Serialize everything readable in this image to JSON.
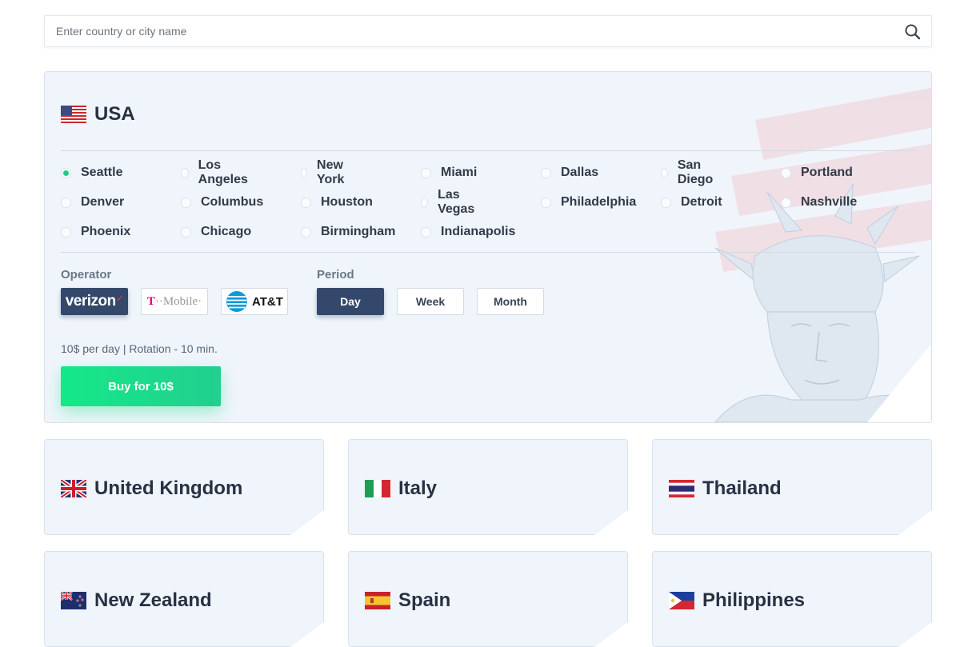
{
  "search": {
    "placeholder": "Enter country or city name"
  },
  "selected_country": {
    "name": "USA",
    "cities": [
      {
        "label": "Seattle",
        "selected": true
      },
      {
        "label": "Los Angeles",
        "selected": false
      },
      {
        "label": "New York",
        "selected": false
      },
      {
        "label": "Miami",
        "selected": false
      },
      {
        "label": "Dallas",
        "selected": false
      },
      {
        "label": "San Diego",
        "selected": false
      },
      {
        "label": "Portland",
        "selected": false
      },
      {
        "label": "Denver",
        "selected": false
      },
      {
        "label": "Columbus",
        "selected": false
      },
      {
        "label": "Houston",
        "selected": false
      },
      {
        "label": "Las Vegas",
        "selected": false
      },
      {
        "label": "Philadelphia",
        "selected": false
      },
      {
        "label": "Detroit",
        "selected": false
      },
      {
        "label": "Nashville",
        "selected": false
      },
      {
        "label": "Phoenix",
        "selected": false
      },
      {
        "label": "Chicago",
        "selected": false
      },
      {
        "label": "Birmingham",
        "selected": false
      },
      {
        "label": "Indianapolis",
        "selected": false
      }
    ],
    "operator_label": "Operator",
    "operators": [
      {
        "name": "verizon",
        "active": true
      },
      {
        "name": "T··Mobile·",
        "active": false
      },
      {
        "name": "AT&T",
        "active": false
      }
    ],
    "period_label": "Period",
    "periods": [
      {
        "label": "Day",
        "active": true
      },
      {
        "label": "Week",
        "active": false
      },
      {
        "label": "Month",
        "active": false
      }
    ],
    "price_info": "10$ per day | Rotation - 10 min.",
    "buy_label": "Buy for 10$"
  },
  "other_countries": [
    {
      "name": "United Kingdom",
      "flag": "uk-flag-icon"
    },
    {
      "name": "Italy",
      "flag": "italy-flag-icon"
    },
    {
      "name": "Thailand",
      "flag": "thailand-flag-icon"
    },
    {
      "name": "New Zealand",
      "flag": "new-zealand-flag-icon"
    },
    {
      "name": "Spain",
      "flag": "spain-flag-icon"
    },
    {
      "name": "Philippines",
      "flag": "philippines-flag-icon"
    }
  ],
  "colors": {
    "accent_green": "#14e888",
    "active_button": "#34486b",
    "card_background": "#eff5fb",
    "radio_selected": "#25c98a"
  }
}
